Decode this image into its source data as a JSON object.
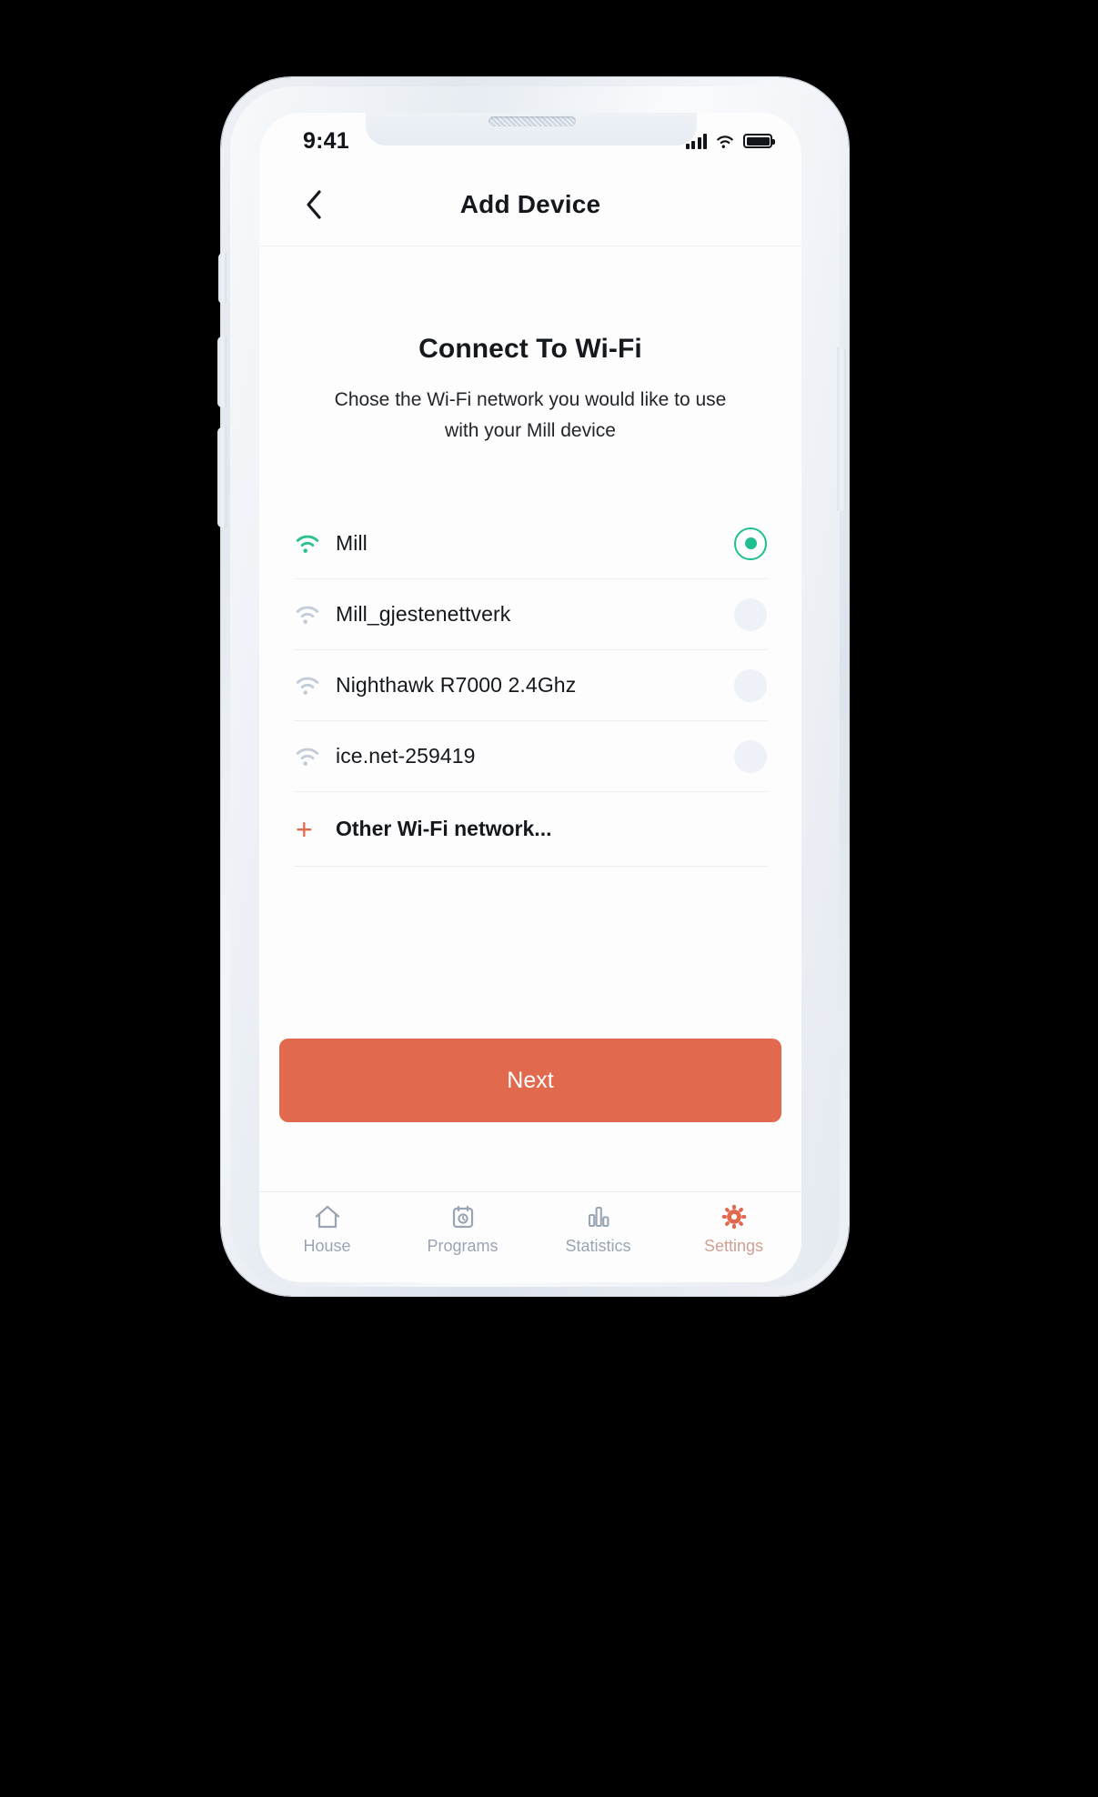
{
  "status_bar": {
    "time": "9:41",
    "signal_icon": "cellular-signal-icon",
    "wifi_icon": "wifi-icon",
    "battery_icon": "battery-full-icon"
  },
  "header": {
    "back_icon": "chevron-left-icon",
    "title": "Add Device"
  },
  "main": {
    "heading": "Connect To Wi-Fi",
    "subtitle": "Chose the Wi-Fi network you would like   to use\nwith your Mill device",
    "networks": [
      {
        "name": "Mill",
        "selected": true,
        "wifi_icon": "wifi-icon"
      },
      {
        "name": "Mill_gjestenettverk",
        "selected": false,
        "wifi_icon": "wifi-icon"
      },
      {
        "name": "Nighthawk R7000 2.4Ghz",
        "selected": false,
        "wifi_icon": "wifi-icon"
      },
      {
        "name": "ice.net-259419",
        "selected": false,
        "wifi_icon": "wifi-icon"
      }
    ],
    "other_network": {
      "plus_icon": "plus-icon",
      "label": "Other Wi-Fi network..."
    },
    "primary_button": "Next"
  },
  "tabbar": {
    "items": [
      {
        "label": "House",
        "icon": "home-icon",
        "active": false
      },
      {
        "label": "Programs",
        "icon": "calendar-clock-icon",
        "active": false
      },
      {
        "label": "Statistics",
        "icon": "bar-chart-icon",
        "active": false
      },
      {
        "label": "Settings",
        "icon": "gear-icon",
        "active": true
      }
    ]
  },
  "colors": {
    "accent_orange": "#e0694e",
    "accent_green": "#1fbf8f",
    "text_primary": "#15191e",
    "text_muted": "#9aa4b2",
    "radio_idle": "#eef1f8"
  }
}
